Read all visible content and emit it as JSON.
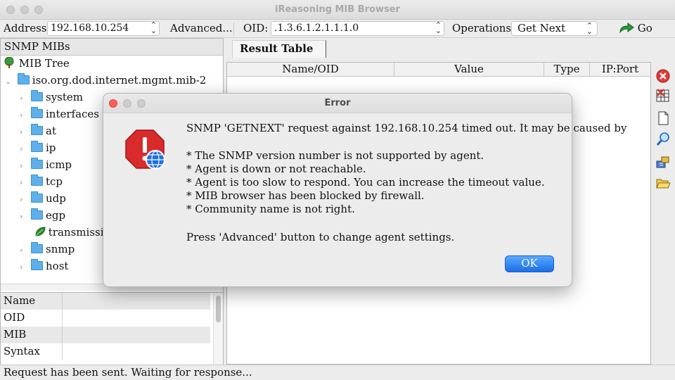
{
  "window": {
    "title": "iReasoning MIB Browser"
  },
  "toolbar": {
    "address_label": "Address:",
    "address_value": "192.168.10.254",
    "advanced_label": "Advanced...",
    "oid_label": "OID:",
    "oid_value": ".1.3.6.1.2.1.1.1.0",
    "operations_label": "Operations:",
    "operation_selected": "Get Next",
    "go_label": "Go"
  },
  "left_panel": {
    "header": "SNMP MIBs",
    "tree": {
      "root": "MIB Tree",
      "branch": "iso.org.dod.internet.mgmt.mib-2",
      "items": [
        {
          "label": "system",
          "icon": "folder-icon"
        },
        {
          "label": "interfaces",
          "icon": "folder-icon"
        },
        {
          "label": "at",
          "icon": "folder-icon"
        },
        {
          "label": "ip",
          "icon": "folder-icon"
        },
        {
          "label": "icmp",
          "icon": "folder-icon"
        },
        {
          "label": "tcp",
          "icon": "folder-icon"
        },
        {
          "label": "udp",
          "icon": "folder-icon"
        },
        {
          "label": "egp",
          "icon": "folder-icon"
        },
        {
          "label": "transmission",
          "icon": "leaf-icon"
        },
        {
          "label": "snmp",
          "icon": "folder-icon"
        },
        {
          "label": "host",
          "icon": "folder-icon"
        }
      ]
    },
    "properties": [
      "Name",
      "OID",
      "MIB",
      "Syntax"
    ]
  },
  "right_panel": {
    "tab": "Result Table",
    "columns": [
      "Name/OID",
      "Value",
      "Type",
      "IP:Port"
    ]
  },
  "status": {
    "text": "Request has been sent. Waiting for response..."
  },
  "dialog": {
    "title": "Error",
    "message": "SNMP 'GETNEXT' request against 192.168.10.254 timed out. It may be caused by",
    "reasons": [
      "* The SNMP version number is not supported by agent.",
      "* Agent is down or not reachable.",
      "* Agent is too slow to respond. You can increase the timeout value.",
      "* MIB browser has been blocked by firewall.",
      "* Community name is not right."
    ],
    "hint": "Press 'Advanced' button to change agent settings.",
    "ok_label": "OK"
  },
  "colors": {
    "accent": "#1a6fe8",
    "error": "#d62a2a",
    "close": "#ff5f57"
  }
}
